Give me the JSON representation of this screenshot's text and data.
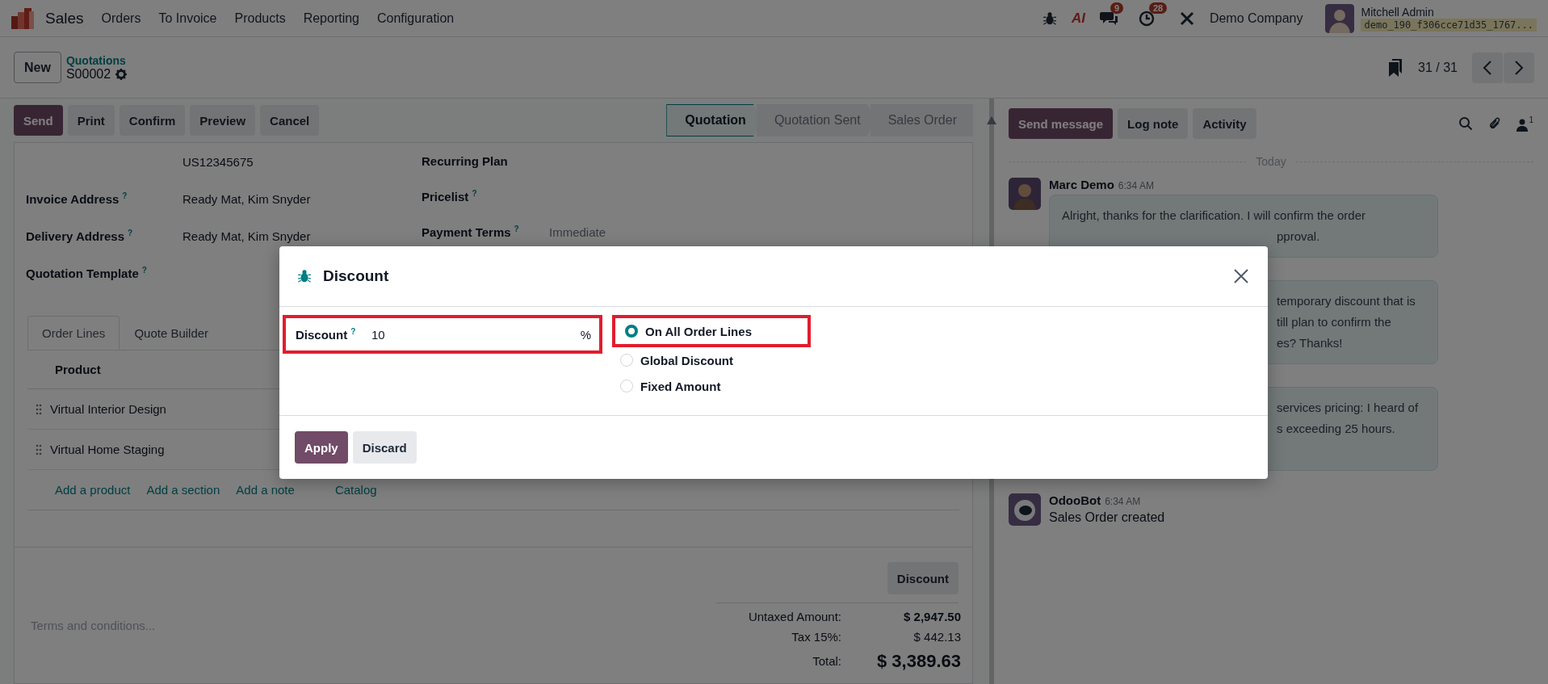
{
  "navbar": {
    "app": "Sales",
    "menu": [
      "Orders",
      "To Invoice",
      "Products",
      "Reporting",
      "Configuration"
    ],
    "ai_label": "AI",
    "chat_count": "9",
    "activity_count": "28",
    "company": "Demo Company",
    "user": "Mitchell Admin",
    "database": "demo_190_f306cce71d35_1767..."
  },
  "control_panel": {
    "new_button": "New",
    "breadcrumb": "Quotations",
    "record": "S00002",
    "pager": "31 / 31"
  },
  "actions": [
    {
      "label": "Send",
      "primary": true
    },
    {
      "label": "Print",
      "primary": false
    },
    {
      "label": "Confirm",
      "primary": false
    },
    {
      "label": "Preview",
      "primary": false
    },
    {
      "label": "Cancel",
      "primary": false
    }
  ],
  "stages": [
    {
      "label": "Quotation",
      "selected": true
    },
    {
      "label": "Quotation Sent",
      "selected": false
    },
    {
      "label": "Sales Order",
      "selected": false
    }
  ],
  "form": {
    "left_fields": [
      {
        "value": "US12345675"
      },
      {
        "label": "Invoice Address",
        "help": "?",
        "value": "Ready Mat, Kim Snyder"
      },
      {
        "label": "Delivery Address",
        "help": "?",
        "value": "Ready Mat, Kim Snyder"
      },
      {
        "label": "Quotation Template",
        "help": "?"
      }
    ],
    "right_fields": [
      {
        "label": "Recurring Plan"
      },
      {
        "label": "Pricelist",
        "help": "?"
      },
      {
        "label": "Payment Terms",
        "help": "?",
        "placeholder": "Immediate"
      }
    ],
    "tabs": [
      {
        "label": "Order Lines",
        "selected": true
      },
      {
        "label": "Quote Builder",
        "selected": false
      }
    ],
    "table": {
      "header": "Product",
      "rows": [
        "Virtual Interior Design",
        "Virtual Home Staging"
      ],
      "add_links": [
        "Add a product",
        "Add a section",
        "Add a note",
        "Catalog"
      ]
    },
    "notes_placeholder": "Terms and conditions...",
    "discount_button": "Discount",
    "totals": [
      {
        "label": "Untaxed Amount:",
        "value": "$ 2,947.50",
        "kind": "subtotal"
      },
      {
        "label": "Tax 15%:",
        "value": "$ 442.13",
        "kind": "tax"
      },
      {
        "label": "Total:",
        "value": "$ 3,389.63",
        "kind": "total"
      }
    ]
  },
  "chatter": {
    "buttons": [
      {
        "label": "Send message",
        "primary": true
      },
      {
        "label": "Log note",
        "primary": false
      },
      {
        "label": "Activity",
        "primary": false
      }
    ],
    "follower_count": "1",
    "date_separator": "Today",
    "messages": [
      {
        "author": "Marc Demo",
        "time": "6:34 AM",
        "kind": "bubble",
        "lines": [
          {
            "text": "Alright, thanks for the clarification. I will confirm the order",
            "kind": "full"
          },
          {
            "text": "pproval.",
            "kind": "fragment"
          }
        ]
      },
      {
        "kind": "bubble",
        "lines": [
          {
            "text": "temporary discount that is",
            "kind": "fragment"
          },
          {
            "text": "till plan to confirm the",
            "kind": "fragment"
          },
          {
            "text": "es? Thanks!",
            "kind": "fragment"
          }
        ]
      },
      {
        "kind": "bubble",
        "lines": [
          {
            "text": "services pricing: I heard of",
            "kind": "fragment"
          },
          {
            "text": "s exceeding 25 hours.",
            "kind": "fragment"
          },
          {
            "kind": "blank"
          }
        ]
      },
      {
        "author": "OdooBot",
        "time": "6:34 AM",
        "kind": "plain",
        "lines": [
          {
            "text": "Sales Order created",
            "kind": "full"
          }
        ]
      }
    ]
  },
  "dialog": {
    "title": "Discount",
    "field_label": "Discount",
    "help": "?",
    "value": "10",
    "suffix": "%",
    "options": [
      {
        "label": "On All Order Lines",
        "selected": true
      },
      {
        "label": "Global Discount",
        "selected": false
      },
      {
        "label": "Fixed Amount",
        "selected": false
      }
    ],
    "buttons": [
      {
        "label": "Apply",
        "primary": true
      },
      {
        "label": "Discard",
        "primary": false
      }
    ]
  }
}
